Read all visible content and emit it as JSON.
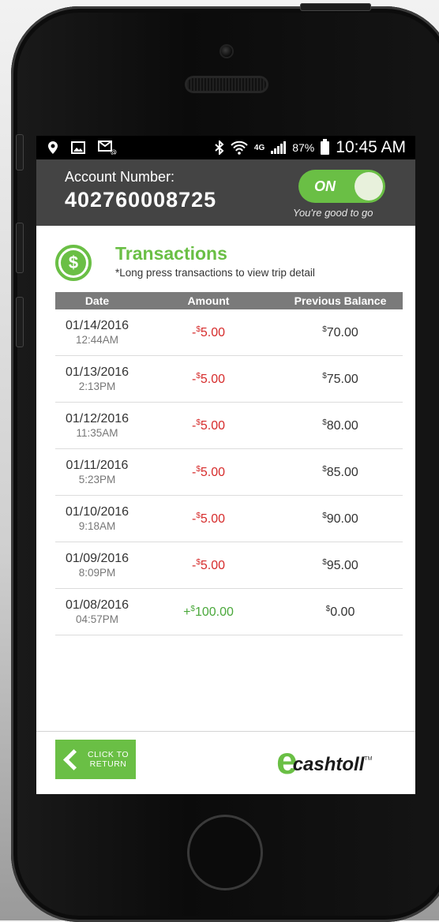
{
  "status_bar": {
    "battery": "87%",
    "time": "10:45 AM",
    "network": "4G",
    "icons": [
      "location-icon",
      "image-icon",
      "message-icon",
      "bluetooth-icon",
      "wifi-icon",
      "signal-icon",
      "battery-icon"
    ]
  },
  "account": {
    "label": "Account Number:",
    "number": "402760008725",
    "toggle_label": "ON",
    "toggle_state": true,
    "status_text": "You're good to go"
  },
  "transactions": {
    "title": "Transactions",
    "subtitle": "*Long press transactions to view trip detail",
    "columns": [
      "Date",
      "Amount",
      "Previous Balance"
    ],
    "rows": [
      {
        "date": "01/14/2016",
        "time": "12:44AM",
        "sign": "-",
        "amount": "5.00",
        "balance": "70.00"
      },
      {
        "date": "01/13/2016",
        "time": "2:13PM",
        "sign": "-",
        "amount": "5.00",
        "balance": "75.00"
      },
      {
        "date": "01/12/2016",
        "time": "11:35AM",
        "sign": "-",
        "amount": "5.00",
        "balance": "80.00"
      },
      {
        "date": "01/11/2016",
        "time": "5:23PM",
        "sign": "-",
        "amount": "5.00",
        "balance": "85.00"
      },
      {
        "date": "01/10/2016",
        "time": "9:18AM",
        "sign": "-",
        "amount": "5.00",
        "balance": "90.00"
      },
      {
        "date": "01/09/2016",
        "time": "8:09PM",
        "sign": "-",
        "amount": "5.00",
        "balance": "95.00"
      },
      {
        "date": "01/08/2016",
        "time": "04:57PM",
        "sign": "+",
        "amount": "100.00",
        "balance": "0.00"
      }
    ],
    "currency_symbol": "$"
  },
  "footer": {
    "return_line1": "CLICK TO",
    "return_line2": "RETURN",
    "logo_e": "e",
    "logo_word": "cashtoll",
    "logo_tm": "TM"
  },
  "colors": {
    "accent": "#6abf45",
    "negative": "#d62b2b",
    "positive": "#4aa83b",
    "header_bg": "#444444"
  }
}
